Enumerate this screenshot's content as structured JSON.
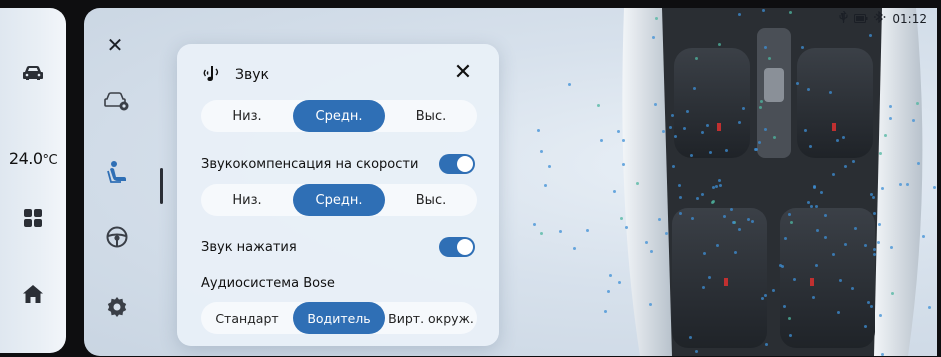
{
  "rail": {
    "temperature": "24.0",
    "temperature_unit": "°C"
  },
  "status_bar": {
    "time": "01:12",
    "icons": [
      "usb-icon",
      "battery-icon",
      "bluetooth-icon"
    ]
  },
  "side_nav": {
    "items": [
      "car-settings-icon",
      "seat-icon",
      "steering-wheel-icon",
      "gear-icon"
    ]
  },
  "panel": {
    "title": "Звук",
    "volume_options": [
      "Низ.",
      "Средн.",
      "Выс."
    ],
    "volume_selected": "Средн.",
    "speed_comp_label": "Звукокомпенсация на скорости",
    "speed_comp_enabled": true,
    "speed_comp_options": [
      "Низ.",
      "Средн.",
      "Выс."
    ],
    "speed_comp_selected": "Средн.",
    "touch_sound_label": "Звук нажатия",
    "touch_sound_enabled": true,
    "bose_label": "Аудиосистема Bose",
    "bose_options": [
      "Стандарт",
      "Водитель",
      "Вирт. окруж."
    ],
    "bose_selected": "Водитель"
  },
  "colors": {
    "accent": "#2f6fb5",
    "panel_bg": "#e9f0f8"
  }
}
